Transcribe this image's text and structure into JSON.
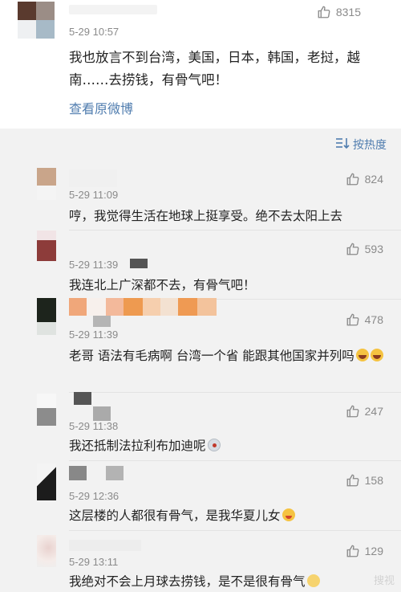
{
  "original_post": {
    "time": "5-29 10:57",
    "likes": "8315",
    "text": "我也放言不到台湾，美国，日本，韩国，老挝，越南……去捞钱，有骨气吧！",
    "view_link": "查看原微博"
  },
  "sort": {
    "label": "按热度"
  },
  "comments": [
    {
      "time": "5-29 11:09",
      "likes": "824",
      "text": "哼，我觉得生活在地球上挺享受。绝不去太阳上去",
      "emojis": []
    },
    {
      "time": "5-29 11:39",
      "likes": "593",
      "text": "我连北上广深都不去，有骨气吧！",
      "emojis": []
    },
    {
      "time": "5-29 11:39",
      "likes": "478",
      "text": "老哥  语法有毛病啊 台湾一个省 能跟其他国家并列吗",
      "emojis": [
        "laugh",
        "laugh"
      ]
    },
    {
      "time": "5-29 11:38",
      "likes": "247",
      "text": "我还抵制法拉利布加迪呢",
      "emojis": [
        "shock"
      ]
    },
    {
      "time": "5-29 12:36",
      "likes": "158",
      "text": "这层楼的人都很有骨气，是我华夏儿女",
      "emojis": [
        "cheeky"
      ]
    },
    {
      "time": "5-29 13:11",
      "likes": "129",
      "text": "我绝对不会上月球去捞钱，是不是很有骨气",
      "emojis": [
        "cat"
      ]
    }
  ],
  "watermark": "搜视"
}
